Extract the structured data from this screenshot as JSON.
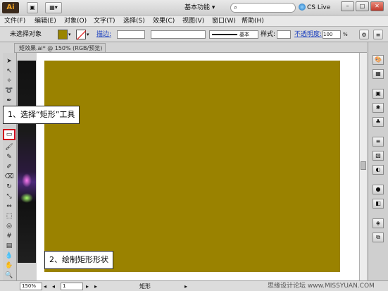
{
  "titlebar": {
    "logo": "Ai",
    "workspace": "基本功能 ▾",
    "cs_live": "CS Live ▾"
  },
  "menu": [
    "文件(F)",
    "编辑(E)",
    "对象(O)",
    "文字(T)",
    "选择(S)",
    "效果(C)",
    "视图(V)",
    "窗口(W)",
    "帮助(H)"
  ],
  "control_bar": {
    "no_selection": "未选择对象",
    "stroke_label": "描边:",
    "brush_label": "基本",
    "style_label": "样式:",
    "opacity_label": "不透明度:",
    "opacity_value": "100",
    "opacity_unit": "%"
  },
  "document": {
    "tab_title": "矩效果.ai* @ 150% (RGB/预览)"
  },
  "callouts": {
    "step1": "1、选择“矩形”工具",
    "step2": "2、绘制矩形形状"
  },
  "colors": {
    "rect_fill": "#9a8200",
    "highlight": "#d0021b"
  },
  "status": {
    "zoom": "150%",
    "page": "1",
    "tool_name": "矩形"
  },
  "watermark": "思缘设计论坛  www.MISSYUAN.COM"
}
